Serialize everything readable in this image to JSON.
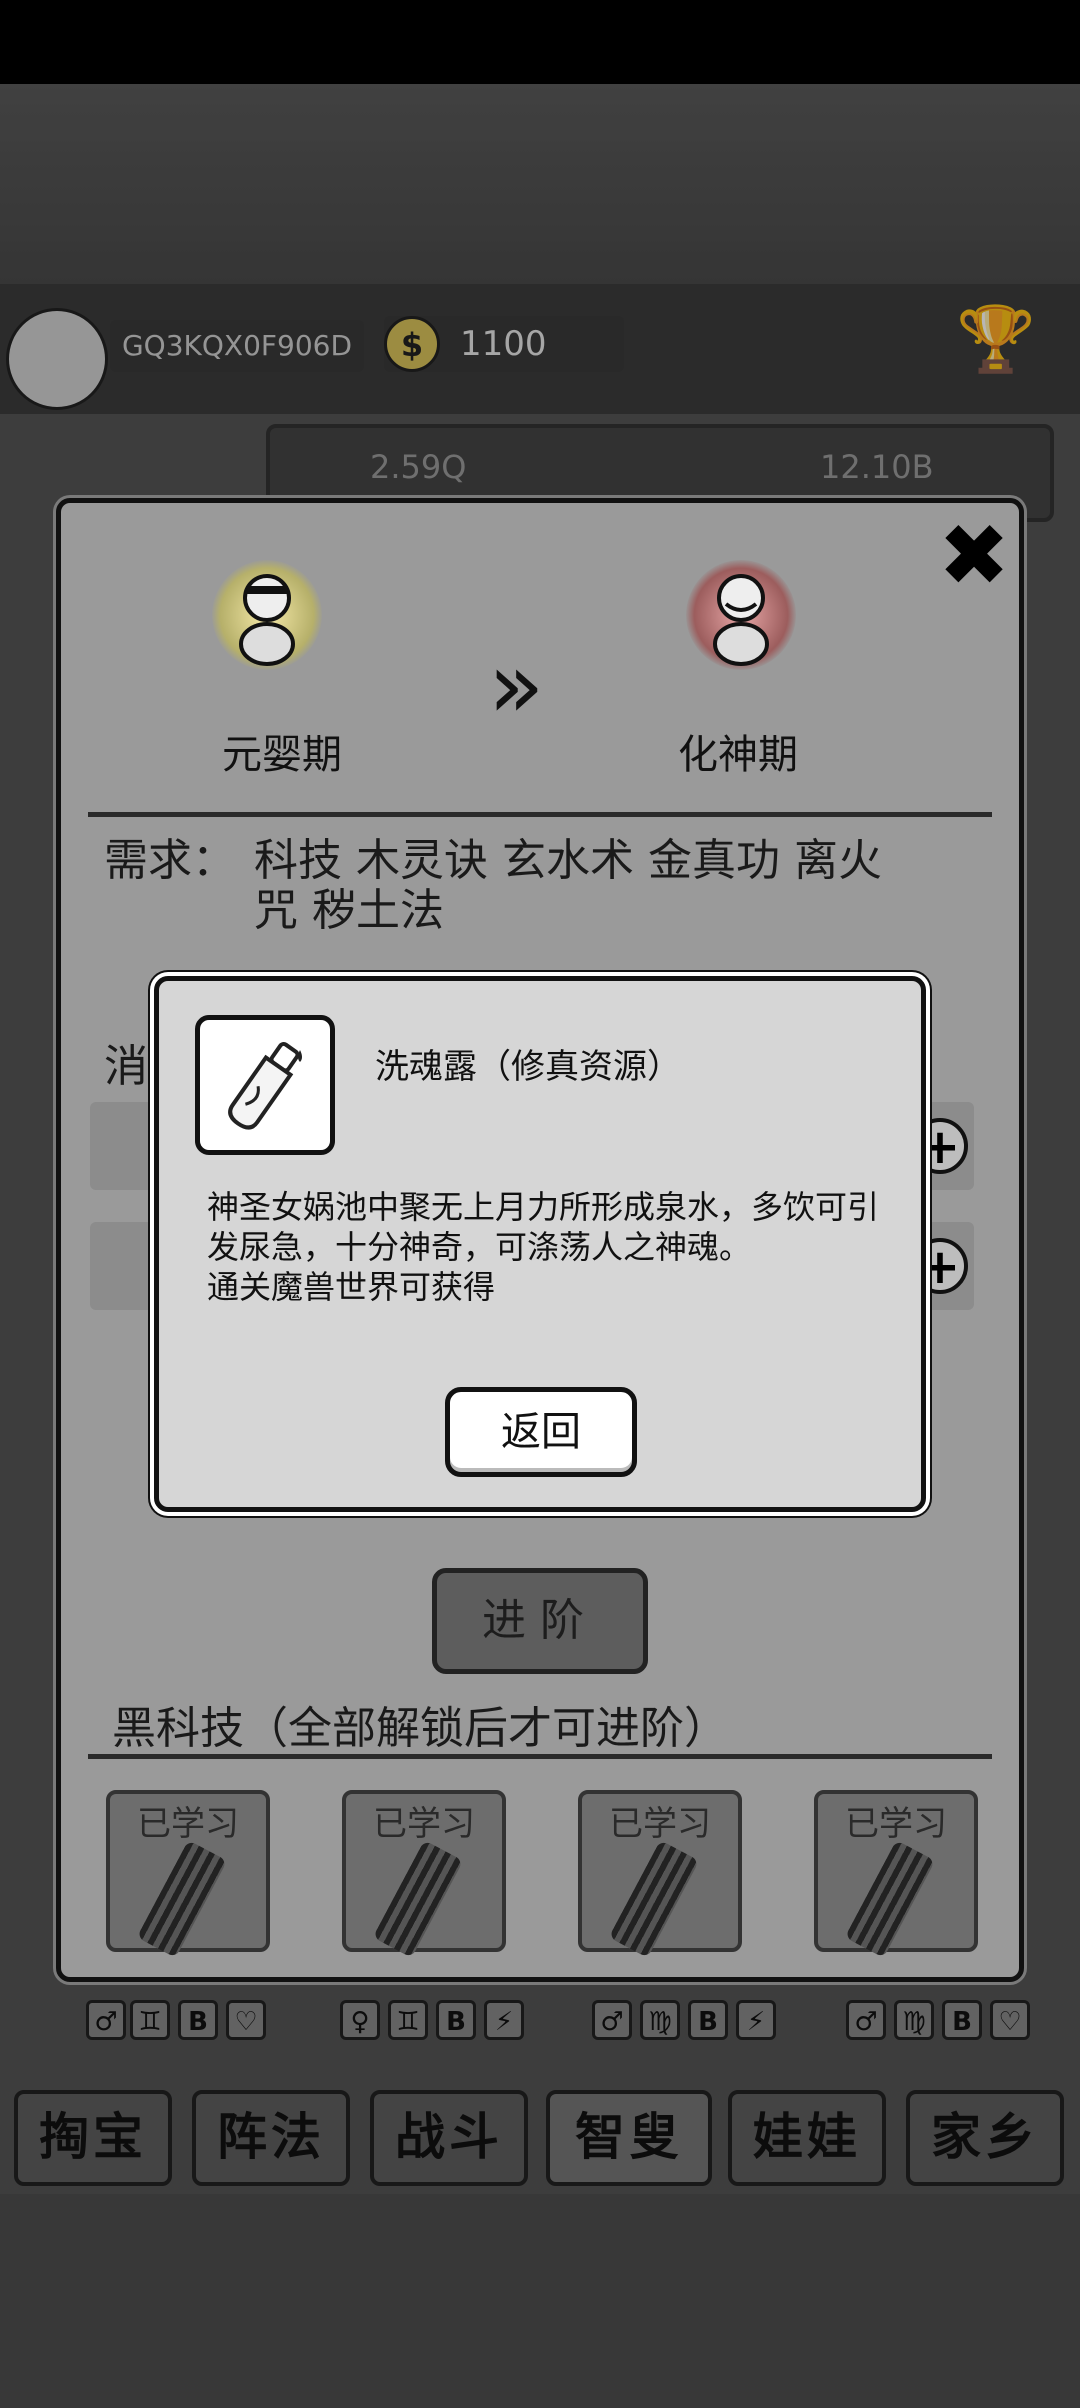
{
  "player": {
    "id": "GQ3KQX0F906D",
    "coins": "1100",
    "coin_symbol": "$"
  },
  "resources": [
    {
      "value": "2.59Q"
    },
    {
      "value": "12.10B"
    }
  ],
  "panel": {
    "close_symbol": "✖",
    "stage_from": "元婴期",
    "stage_to": "化神期",
    "arrow_symbol": "»",
    "requirement_label": "需求：",
    "requirement_items": "科技 木灵诀 玄水术 金真功 离火咒 秽土法",
    "consume_label": "消",
    "advance_label": "进阶",
    "tech_title": "黑科技（全部解锁后才可进阶）",
    "tech_items": [
      {
        "label": "已学习"
      },
      {
        "label": "已学习"
      },
      {
        "label": "已学习"
      },
      {
        "label": "已学习"
      }
    ]
  },
  "modal": {
    "title": "洗魂露（修真资源）",
    "description": "神圣女娲池中聚无上月力所形成泉水，多饮可引发尿急，十分神奇，可涤荡人之神魂。",
    "source": "通关魔兽世界可获得",
    "back_label": "返回"
  },
  "bottom_tabs": [
    {
      "label": "掏宝"
    },
    {
      "label": "阵法"
    },
    {
      "label": "战斗"
    },
    {
      "label": "智叟"
    },
    {
      "label": "娃娃"
    },
    {
      "label": "家乡"
    }
  ],
  "colors": {
    "panel_bg": "#9a9a9a",
    "modal_bg": "#d6d6d6",
    "outline": "#111111",
    "coin": "#d9c35a"
  }
}
